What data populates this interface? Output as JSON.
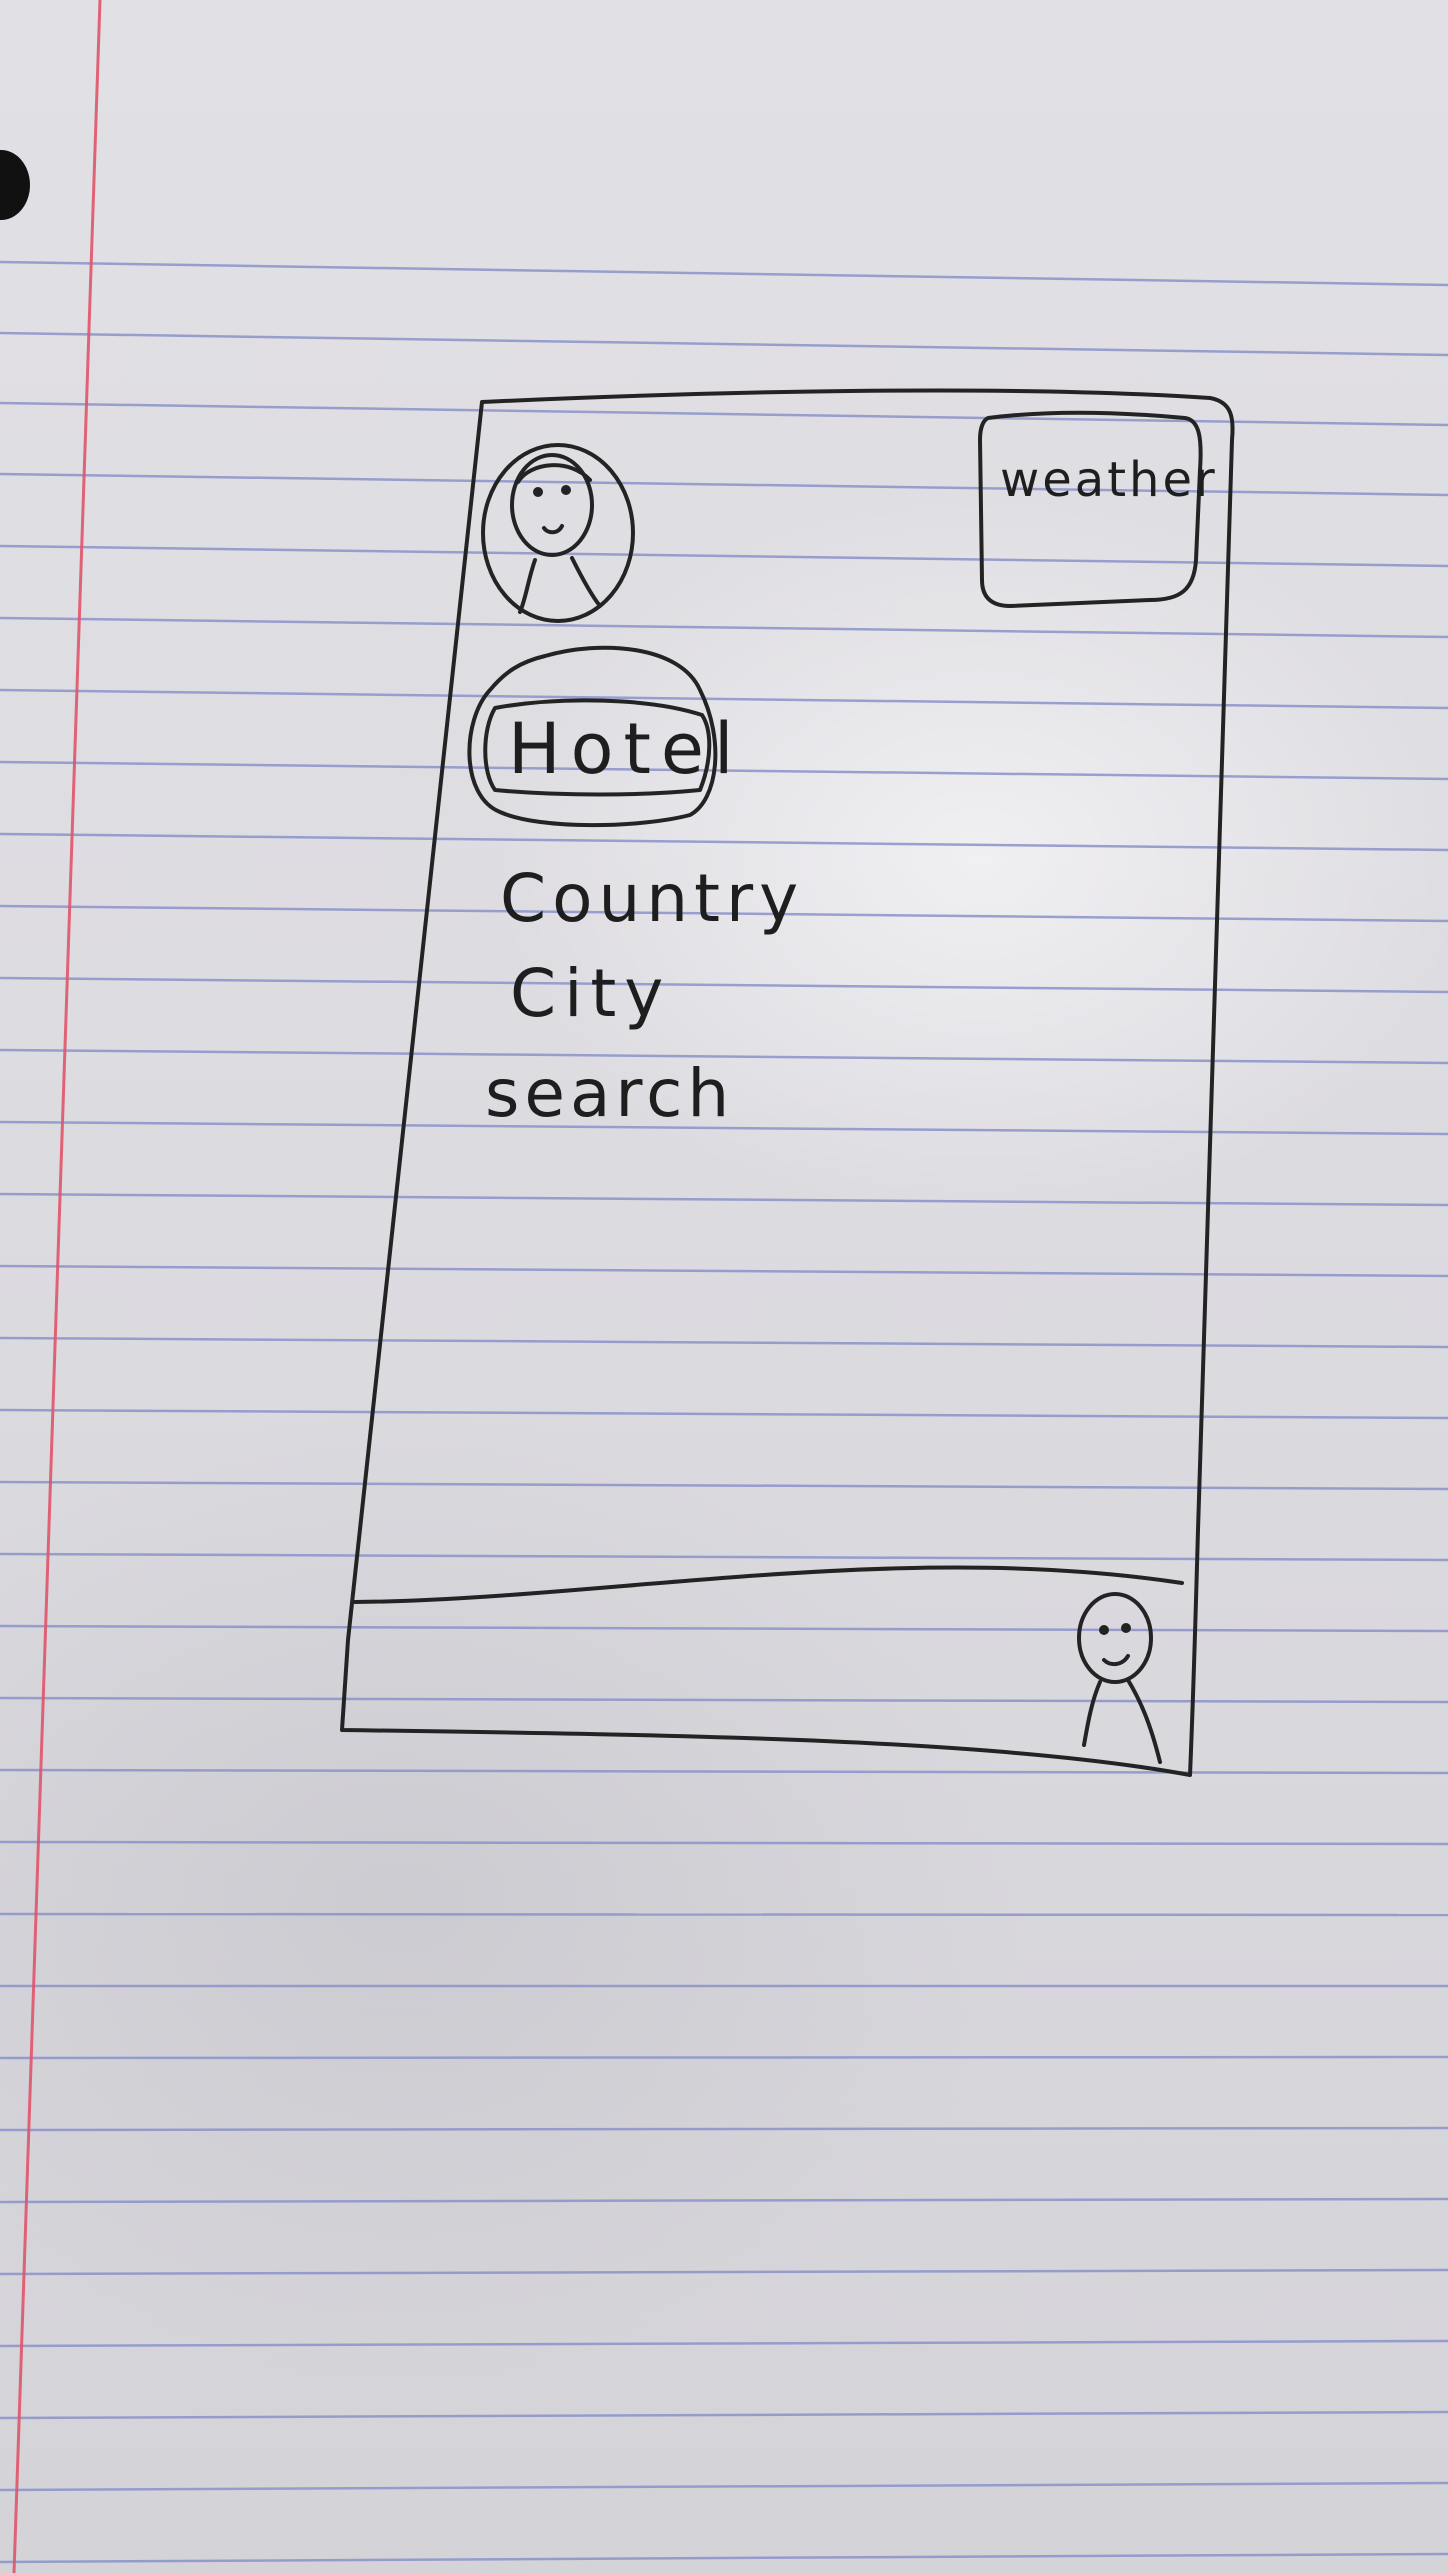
{
  "weather": {
    "label": "weather"
  },
  "hotel": {
    "label": "Hotel"
  },
  "form": {
    "country_label": "Country",
    "city_label": "City",
    "search_label": "search"
  },
  "icons": {
    "profile": "person-face-icon",
    "bottom_nav": "person-icon"
  },
  "colors": {
    "ink": "#222222",
    "rule_line": "#8b93c9",
    "margin_line": "#e0556b",
    "paper": "#dedde2"
  }
}
